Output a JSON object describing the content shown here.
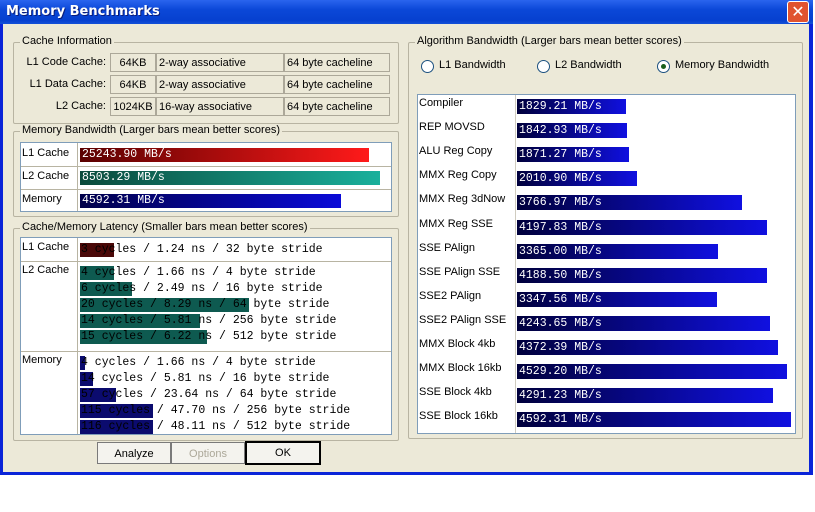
{
  "window": {
    "title": "Memory Benchmarks",
    "close_glyph": "✕"
  },
  "cache_info": {
    "legend": "Cache Information",
    "rows": [
      {
        "label": "L1 Code Cache:",
        "size": "64KB",
        "assoc": "2-way associative",
        "line": "64 byte cacheline"
      },
      {
        "label": "L1 Data Cache:",
        "size": "64KB",
        "assoc": "2-way associative",
        "line": "64 byte cacheline"
      },
      {
        "label": "L2 Cache:",
        "size": "1024KB",
        "assoc": "16-way associative",
        "line": "64 byte cacheline"
      }
    ]
  },
  "mem_bw": {
    "legend": "Memory Bandwidth (Larger bars mean better scores)",
    "rows": [
      {
        "label": "L1 Cache",
        "value": "25243.90 MB/s",
        "fill": 0.964,
        "color_from": "#5a0000",
        "color_to": "#ff1a1a"
      },
      {
        "label": "L2 Cache",
        "value": "8503.29 MB/s",
        "fill": 1.0,
        "color_from": "#0a4a3c",
        "color_to": "#1ab09c"
      },
      {
        "label": "Memory",
        "value": "4592.31 MB/s",
        "fill": 0.87,
        "color_from": "#00004a",
        "color_to": "#0a0ad8"
      }
    ]
  },
  "latency": {
    "legend": "Cache/Memory Latency (Smaller bars mean better scores)",
    "groups": [
      {
        "label": "L1 Cache",
        "color": "#4a0808",
        "rows": [
          {
            "text": "3 cycles / 1.24 ns / 32 byte stride",
            "fill": 0.13
          }
        ]
      },
      {
        "label": "L2 Cache",
        "color": "#0e5a50",
        "rows": [
          {
            "text": "4 cycles / 1.66 ns / 4 byte stride",
            "fill": 0.13
          },
          {
            "text": "6 cycles / 2.49 ns / 16 byte stride",
            "fill": 0.2
          },
          {
            "text": "20 cycles / 8.29 ns / 64 byte stride",
            "fill": 0.65
          },
          {
            "text": "14 cycles / 5.81 ns / 256 byte stride",
            "fill": 0.46
          },
          {
            "text": "15 cycles / 6.22 ns / 512 byte stride",
            "fill": 0.49
          }
        ]
      },
      {
        "label": "Memory",
        "color": "#0b0b6e",
        "rows": [
          {
            "text": "4 cycles / 1.66 ns / 4 byte stride",
            "fill": 0.02
          },
          {
            "text": "14 cycles / 5.81 ns / 16 byte stride",
            "fill": 0.05
          },
          {
            "text": "57 cycles / 23.64 ns / 64 byte stride",
            "fill": 0.14
          },
          {
            "text": "115 cycles / 47.70 ns / 256 byte stride",
            "fill": 0.28
          },
          {
            "text": "116 cycles / 48.11 ns / 512 byte stride",
            "fill": 0.28
          }
        ]
      }
    ]
  },
  "algo": {
    "legend": "Algorithm Bandwidth (Larger bars mean better scores)",
    "radios": [
      {
        "label": "L1 Bandwidth",
        "selected": false
      },
      {
        "label": "L2 Bandwidth",
        "selected": false
      },
      {
        "label": "Memory Bandwidth",
        "selected": true
      }
    ],
    "bar_color_from": "#00003c",
    "bar_color_to": "#1010e0",
    "rows": [
      {
        "label": "Compiler",
        "value": "1829.21 MB/s",
        "mbps": 1829.21
      },
      {
        "label": "REP MOVSD",
        "value": "1842.93 MB/s",
        "mbps": 1842.93
      },
      {
        "label": "ALU Reg Copy",
        "value": "1871.27 MB/s",
        "mbps": 1871.27
      },
      {
        "label": "MMX Reg Copy",
        "value": "2010.90 MB/s",
        "mbps": 2010.9
      },
      {
        "label": "MMX Reg 3dNow",
        "value": "3766.97 MB/s",
        "mbps": 3766.97
      },
      {
        "label": "MMX Reg SSE",
        "value": "4197.83 MB/s",
        "mbps": 4197.83
      },
      {
        "label": "SSE PAlign",
        "value": "3365.00 MB/s",
        "mbps": 3365.0
      },
      {
        "label": "SSE PAlign SSE",
        "value": "4188.50 MB/s",
        "mbps": 4188.5
      },
      {
        "label": "SSE2 PAlign",
        "value": "3347.56 MB/s",
        "mbps": 3347.56
      },
      {
        "label": "SSE2 PAlign SSE",
        "value": "4243.65 MB/s",
        "mbps": 4243.65
      },
      {
        "label": "MMX Block 4kb",
        "value": "4372.39 MB/s",
        "mbps": 4372.39
      },
      {
        "label": "MMX Block 16kb",
        "value": "4529.20 MB/s",
        "mbps": 4529.2
      },
      {
        "label": "SSE Block 4kb",
        "value": "4291.23 MB/s",
        "mbps": 4291.23
      },
      {
        "label": "SSE Block 16kb",
        "value": "4592.31 MB/s",
        "mbps": 4592.31
      }
    ]
  },
  "buttons": {
    "analyze": "Analyze",
    "options": "Options",
    "ok": "OK"
  }
}
